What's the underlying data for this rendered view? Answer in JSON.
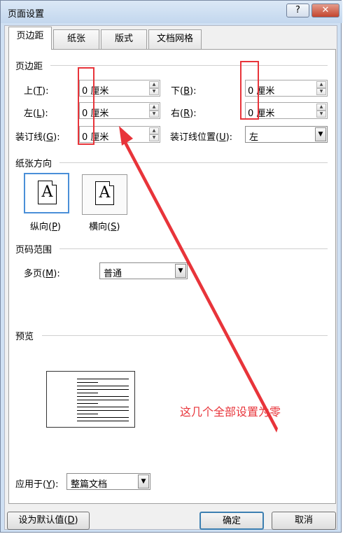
{
  "window": {
    "title": "页面设置",
    "help_label": "?",
    "close_label": "✕"
  },
  "tabs": [
    {
      "label": "页边距",
      "active": true
    },
    {
      "label": "纸张",
      "active": false
    },
    {
      "label": "版式",
      "active": false
    },
    {
      "label": "文档网格",
      "active": false
    }
  ],
  "margins": {
    "section_title": "页边距",
    "top": {
      "label_text": "上(",
      "key": "T",
      "label_end": "):",
      "value": "0 厘米"
    },
    "bottom": {
      "label_text": "下(",
      "key": "B",
      "label_end": "):",
      "value": "0 厘米"
    },
    "left": {
      "label_text": "左(",
      "key": "L",
      "label_end": "):",
      "value": "0 厘米"
    },
    "right": {
      "label_text": "右(",
      "key": "R",
      "label_end": "):",
      "value": "0 厘米"
    },
    "gutter": {
      "label_text": "装订线(",
      "key": "G",
      "label_end": "):",
      "value": "0 厘米"
    },
    "gutter_position": {
      "label_text": "装订线位置(",
      "key": "U",
      "label_end": "):",
      "value": "左"
    }
  },
  "orientation": {
    "section_title": "纸张方向",
    "icon_letter": "A",
    "portrait": {
      "label_text": "纵向(",
      "key": "P",
      "label_end": ")",
      "selected": true
    },
    "landscape": {
      "label_text": "横向(",
      "key": "S",
      "label_end": ")",
      "selected": false
    }
  },
  "pages": {
    "section_title": "页码范围",
    "multiple": {
      "label_text": "多页(",
      "key": "M",
      "label_end": "):",
      "value": "普通"
    }
  },
  "preview": {
    "section_title": "预览"
  },
  "apply_to": {
    "label_text": "应用于(",
    "key": "Y",
    "label_end": "):",
    "value": "整篇文档"
  },
  "buttons": {
    "set_default": {
      "label_text": "设为默认值(",
      "key": "D",
      "label_end": ")"
    },
    "ok": "确定",
    "cancel": "取消"
  },
  "annotation": {
    "text": "这几个全部设置为零",
    "color": "#e8343a"
  },
  "colors": {
    "title_bar": "#cfe0f3",
    "selection_border": "#4a8fd8",
    "annotation_red": "#e8343a"
  }
}
